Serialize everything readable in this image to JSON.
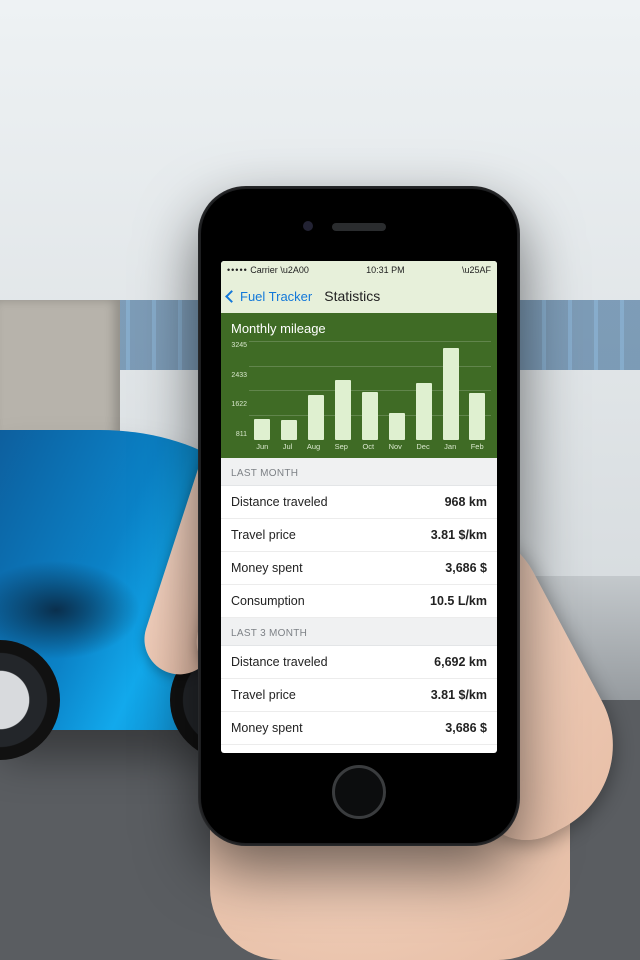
{
  "status_bar": {
    "carrier": "Carrier",
    "signal": "•••••",
    "wifi": "▲",
    "time": "10:31 PM",
    "battery": "▮"
  },
  "nav": {
    "back_label": "Fuel Tracker",
    "title": "Statistics"
  },
  "chart_data": {
    "type": "bar",
    "title": "Monthly mileage",
    "categories": [
      "Jun",
      "Jul",
      "Aug",
      "Sep",
      "Oct",
      "Nov",
      "Dec",
      "Jan",
      "Feb"
    ],
    "values": [
      700,
      650,
      1500,
      2000,
      1600,
      900,
      1900,
      3050,
      1550
    ],
    "yticks": [
      3245,
      2433,
      1622,
      811
    ],
    "ylim": [
      0,
      3245
    ],
    "xlabel": "",
    "ylabel": ""
  },
  "sections": [
    {
      "header": "LAST MONTH",
      "rows": [
        {
          "label": "Distance traveled",
          "value": "968 km"
        },
        {
          "label": "Travel price",
          "value": "3.81 $/km"
        },
        {
          "label": "Money spent",
          "value": "3,686 $"
        },
        {
          "label": "Consumption",
          "value": "10.5 L/km"
        }
      ]
    },
    {
      "header": "LAST 3 MONTH",
      "rows": [
        {
          "label": "Distance traveled",
          "value": "6,692 km"
        },
        {
          "label": "Travel price",
          "value": "3.81 $/km"
        },
        {
          "label": "Money spent",
          "value": "3,686 $"
        }
      ]
    }
  ]
}
